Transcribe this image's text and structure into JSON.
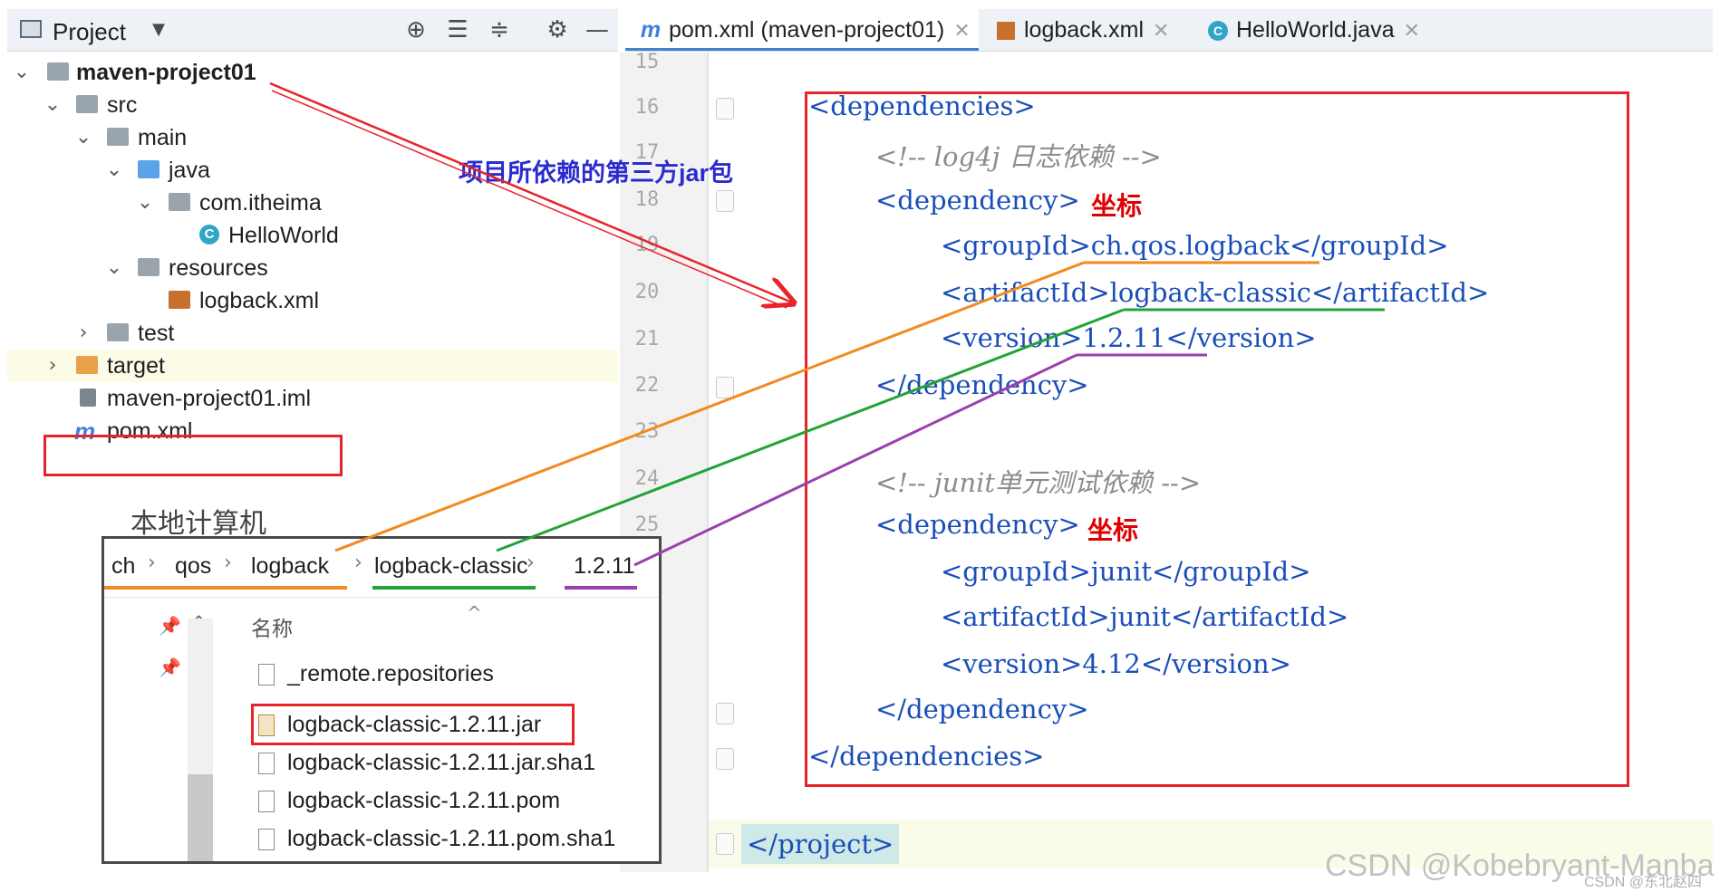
{
  "project_panel": {
    "title": "Project",
    "tree": [
      {
        "label": "maven-project01",
        "icon": "module-folder-icon",
        "bold": true
      },
      {
        "label": "src",
        "icon": "folder-icon"
      },
      {
        "label": "main",
        "icon": "folder-icon"
      },
      {
        "label": "java",
        "icon": "source-folder-icon"
      },
      {
        "label": "com.itheima",
        "icon": "package-icon"
      },
      {
        "label": "HelloWorld",
        "icon": "java-class-icon"
      },
      {
        "label": "resources",
        "icon": "resources-folder-icon"
      },
      {
        "label": "logback.xml",
        "icon": "xml-file-icon"
      },
      {
        "label": "test",
        "icon": "folder-icon"
      },
      {
        "label": "target",
        "icon": "excluded-folder-icon"
      },
      {
        "label": "maven-project01.iml",
        "icon": "iml-file-icon"
      },
      {
        "label": "pom.xml",
        "icon": "maven-icon"
      }
    ]
  },
  "tabs": [
    {
      "label": "pom.xml (maven-project01)",
      "icon": "maven-icon",
      "active": true
    },
    {
      "label": "logback.xml",
      "icon": "xml-file-icon",
      "active": false
    },
    {
      "label": "HelloWorld.java",
      "icon": "java-class-icon",
      "active": false
    }
  ],
  "editor": {
    "line_numbers": [
      "15",
      "16",
      "17",
      "18",
      "19",
      "20",
      "21",
      "22",
      "23",
      "24",
      "25"
    ],
    "lines": {
      "deps_open": "<dependencies>",
      "comment1": "<!-- log4j 日志依赖 -->",
      "dep1_open": "<dependency>",
      "dep1_group": "<groupId>ch.qos.logback</groupId>",
      "dep1_artifact": "<artifactId>logback-classic</artifactId>",
      "dep1_version": "<version>1.2.11</version>",
      "dep1_close": "</dependency>",
      "comment2": "<!-- junit单元测试依赖 -->",
      "dep2_open": "<dependency>",
      "dep2_group": "<groupId>junit</groupId>",
      "dep2_artifact": "<artifactId>junit</artifactId>",
      "dep2_version": "<version>4.12</version>",
      "dep2_close": "</dependency>",
      "deps_close": "</dependencies>",
      "project_close": "</project>"
    },
    "note_coord": "坐标"
  },
  "annotations": {
    "deps_label": "项目所依赖的第三方jar包",
    "local_computer": "本地计算机"
  },
  "explorer": {
    "breadcrumb": [
      "ch",
      "qos",
      "logback",
      "logback-classic",
      "1.2.11"
    ],
    "column_header": "名称",
    "files": [
      "_remote.repositories",
      "logback-classic-1.2.11.jar",
      "logback-classic-1.2.11.jar.sha1",
      "logback-classic-1.2.11.pom",
      "logback-classic-1.2.11.pom.sha1"
    ]
  },
  "watermark": {
    "text": "CSDN @Kobebryant-Manba",
    "sub": "CSDN @东北赵四"
  },
  "colors": {
    "highlight_red": "#e8232a",
    "orange": "#f28a1e",
    "green": "#21a336",
    "purple": "#9a3fb0",
    "tag_blue": "#1a4fb8",
    "annotation_blue": "#2b2bd0"
  }
}
